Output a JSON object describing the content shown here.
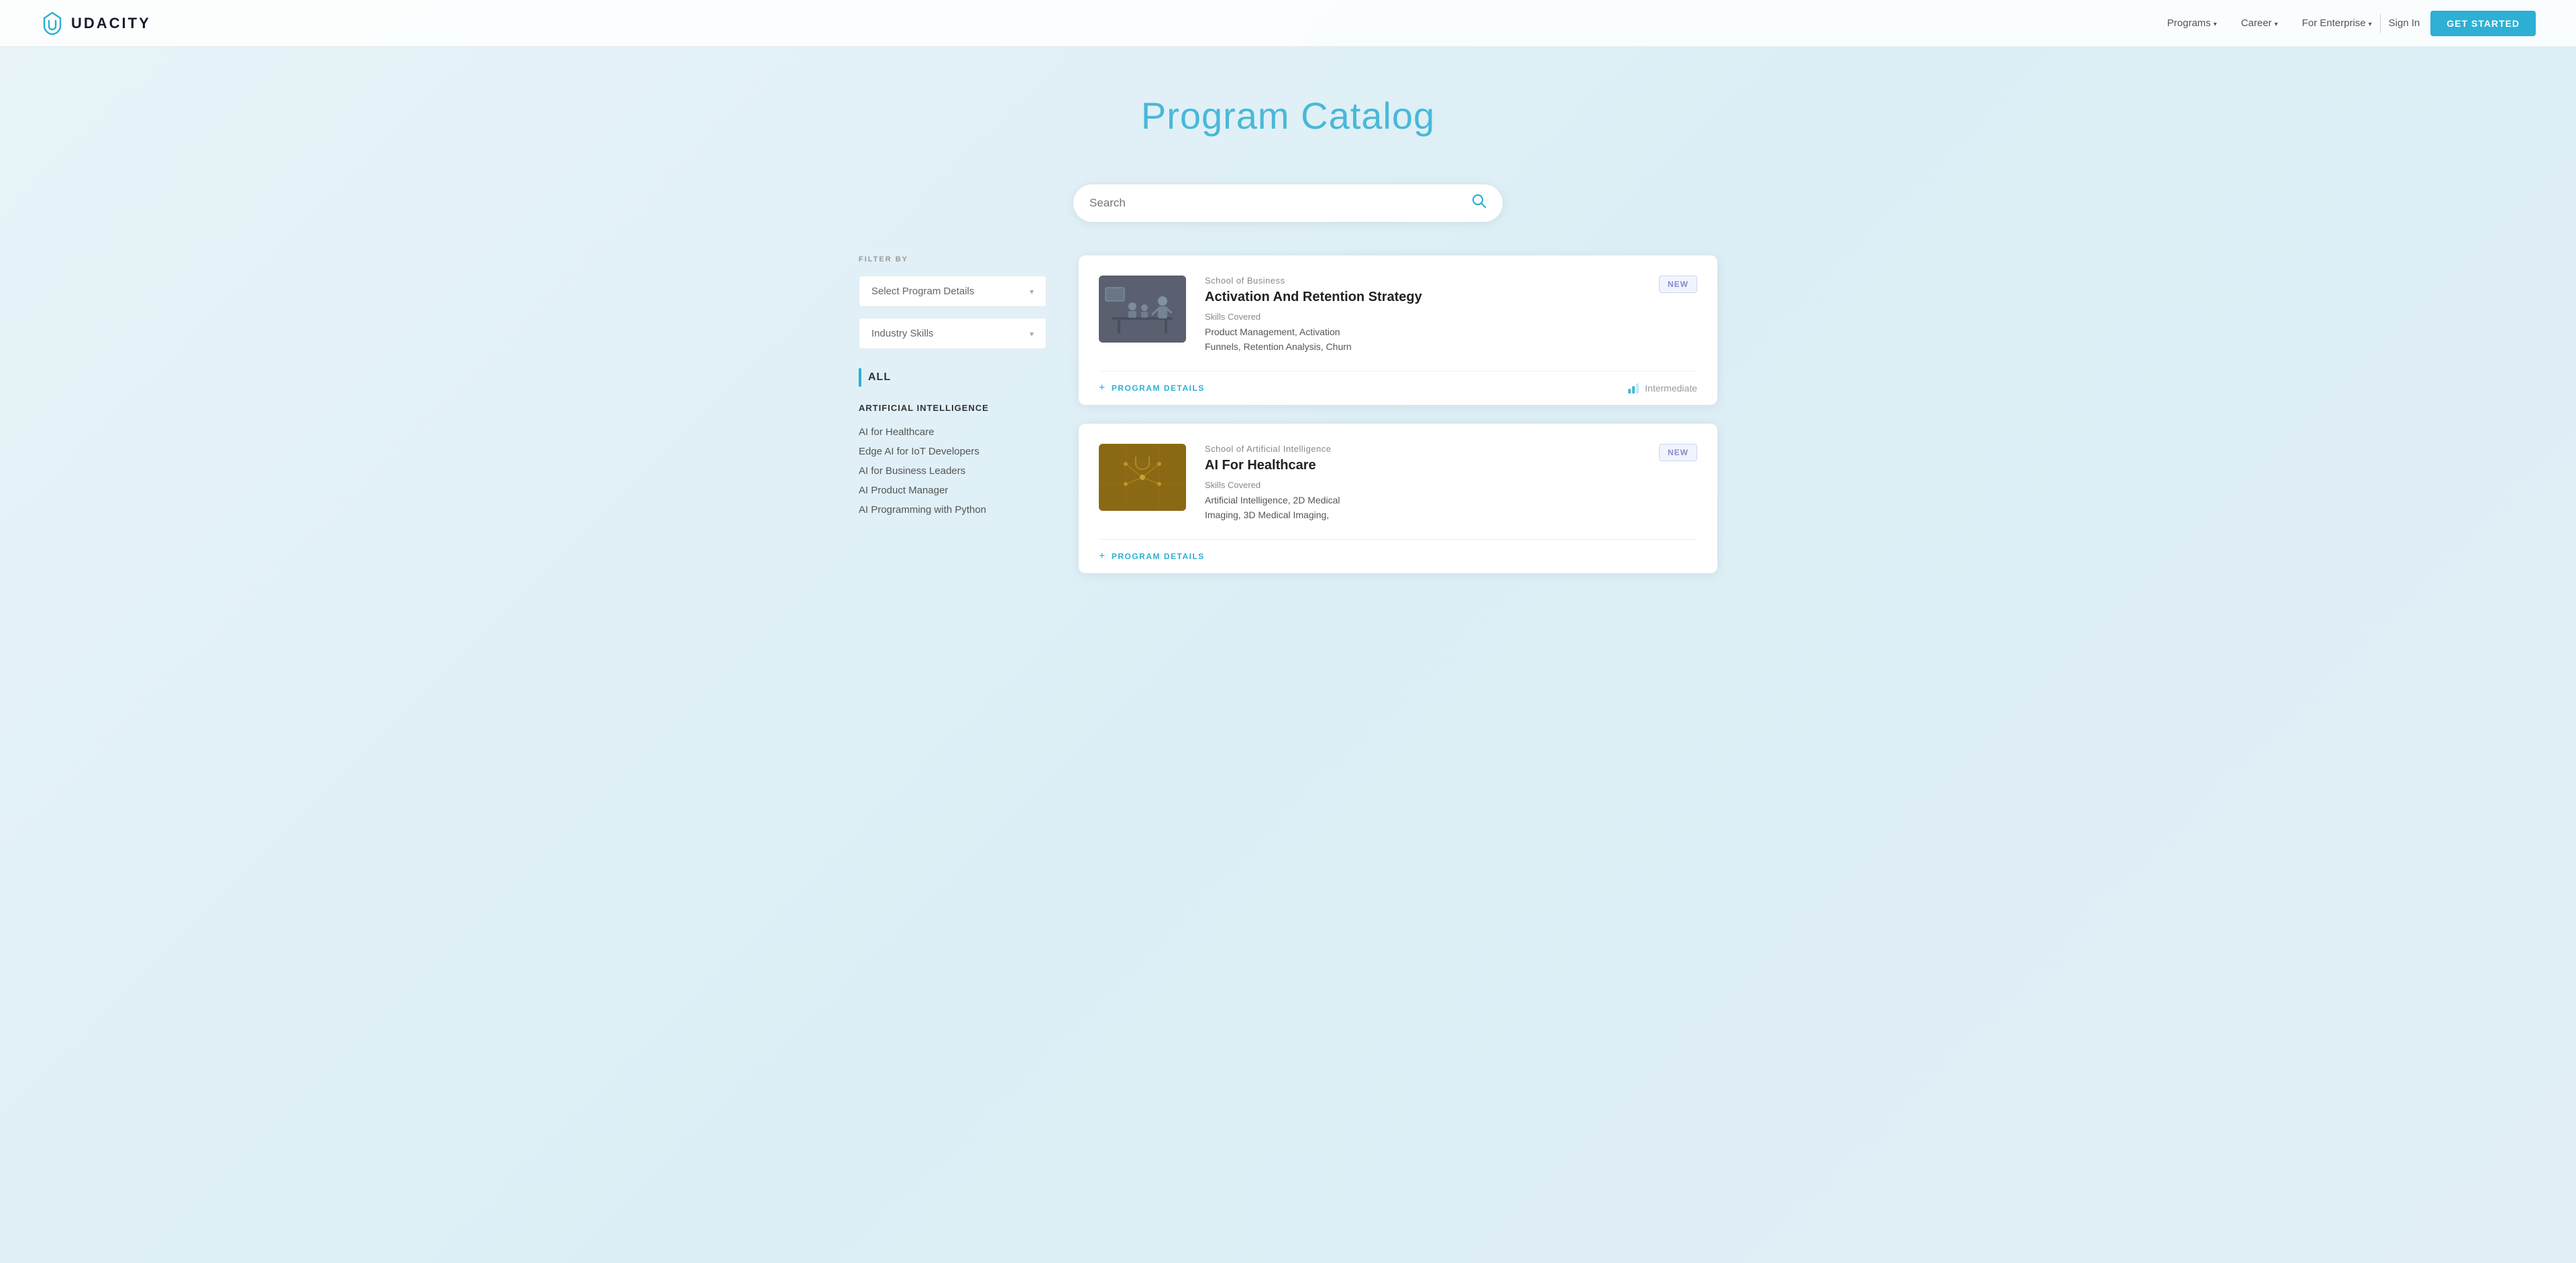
{
  "navbar": {
    "logo_text": "UDACITY",
    "nav_items": [
      {
        "label": "Programs",
        "has_dropdown": true
      },
      {
        "label": "Career",
        "has_dropdown": true
      },
      {
        "label": "For Enterprise",
        "has_dropdown": true
      }
    ],
    "signin_label": "Sign In",
    "get_started_label": "GET STARTED"
  },
  "hero": {
    "title": "Program Catalog"
  },
  "search": {
    "placeholder": "Search"
  },
  "sidebar": {
    "filter_label": "FILTER BY",
    "select_program_label": "Select Program Details",
    "industry_skills_label": "Industry Skills",
    "all_label": "ALL",
    "categories": [
      {
        "title": "ARTIFICIAL INTELLIGENCE",
        "items": [
          "AI for Healthcare",
          "Edge AI for IoT Developers",
          "AI for Business Leaders",
          "AI Product Manager",
          "AI Programming with Python"
        ]
      }
    ]
  },
  "cards": [
    {
      "id": "activation-retention",
      "school": "School of Business",
      "title": "Activation And Retention Strategy",
      "skills_label": "Skills Covered",
      "skills": "Product Management, Activation Funnels, Retention Analysis, Churn",
      "badge": "NEW",
      "footer_btn": "PROGRAM DETAILS",
      "level": "Intermediate",
      "image_type": "business"
    },
    {
      "id": "ai-healthcare",
      "school": "School of Artificial Intelligence",
      "title": "AI For Healthcare",
      "skills_label": "Skills Covered",
      "skills": "Artificial Intelligence, 2D Medical Imaging, 3D Medical Imaging,",
      "badge": "NEW",
      "footer_btn": "PROGRAM DETAILS",
      "level": "",
      "image_type": "ai"
    }
  ]
}
